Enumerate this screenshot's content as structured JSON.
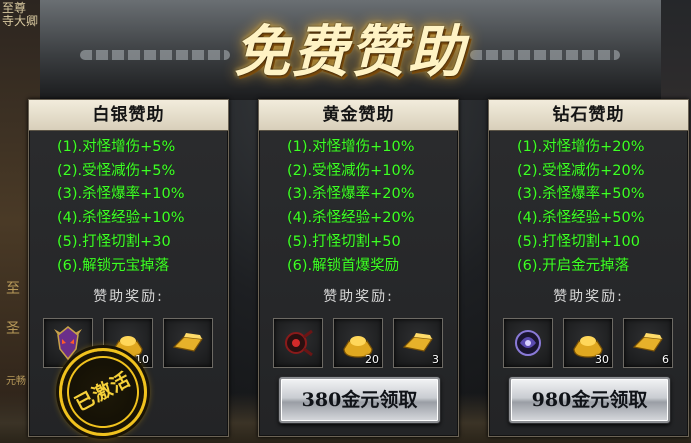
{
  "banner": {
    "title": "免费赞助"
  },
  "backdrop": {
    "corner_text": "至尊\n寺大卿",
    "side_glyphs": [
      "至",
      "圣",
      "元畅"
    ]
  },
  "panels": [
    {
      "title": "白银赞助",
      "lines": [
        "(1).对怪增伤+5%",
        "(2).受怪减伤+5%",
        "(3).杀怪爆率+10%",
        "(4).杀怪经验+10%",
        "(5).打怪切割+30",
        "(6).解锁元宝掉落"
      ],
      "reward_label": "赞助奖励:",
      "rewards": [
        {
          "icon": "demon-mask-icon",
          "count": ""
        },
        {
          "icon": "gold-ingot-icon",
          "count": "10"
        },
        {
          "icon": "gold-bar-icon",
          "count": ""
        }
      ],
      "stamp": "已激活"
    },
    {
      "title": "黄金赞助",
      "lines": [
        "(1).对怪增伤+10%",
        "(2).受怪减伤+10%",
        "(3).杀怪爆率+20%",
        "(4).杀怪经验+20%",
        "(5).打怪切割+50",
        "(6).解锁首爆奖励"
      ],
      "reward_label": "赞助奖励:",
      "rewards": [
        {
          "icon": "red-amulet-icon",
          "count": ""
        },
        {
          "icon": "gold-ingot-icon",
          "count": "20"
        },
        {
          "icon": "gold-bar-icon",
          "count": "3"
        }
      ],
      "button": "380金元领取"
    },
    {
      "title": "钻石赞助",
      "lines": [
        "(1).对怪增伤+20%",
        "(2).受怪减伤+20%",
        "(3).杀怪爆率+50%",
        "(4).杀怪经验+50%",
        "(5).打怪切割+100",
        "(6).开启金元掉落"
      ],
      "reward_label": "赞助奖励:",
      "rewards": [
        {
          "icon": "purple-crest-icon",
          "count": ""
        },
        {
          "icon": "gold-ingot-icon",
          "count": "30"
        },
        {
          "icon": "gold-bar-icon",
          "count": "6"
        }
      ],
      "button": "980金元领取"
    }
  ],
  "colors": {
    "bonus_text": "#3fff26",
    "stamp": "#f0c21e",
    "banner_glow": "#e8a82a"
  }
}
